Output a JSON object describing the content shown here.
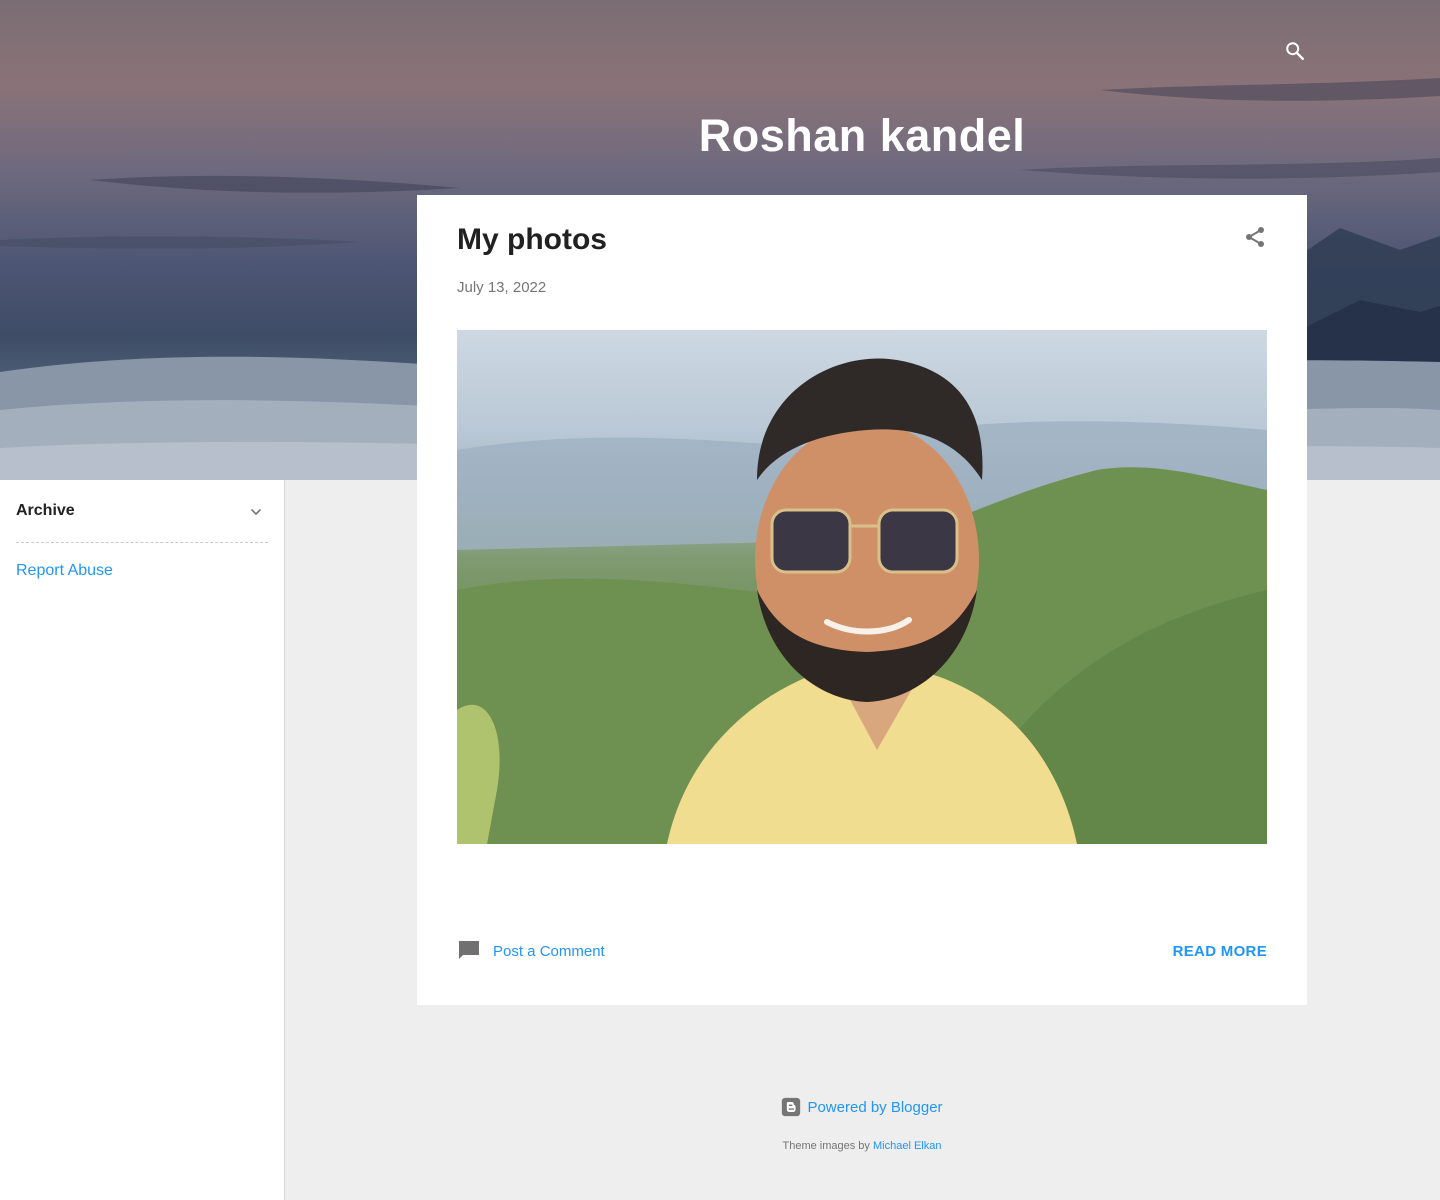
{
  "header": {
    "blog_title": "Roshan kandel",
    "search_icon": "search-icon"
  },
  "sidebar": {
    "archive_label": "Archive",
    "archive_icon": "chevron-down-icon",
    "report_abuse_label": "Report Abuse"
  },
  "post": {
    "title": "My photos",
    "date": "July 13, 2022",
    "share_icon": "share-icon",
    "comment_icon": "comment-icon",
    "comment_label": "Post a Comment",
    "read_more_label": "Read more"
  },
  "footer": {
    "powered_icon": "blogger-icon",
    "powered_label": "Powered by Blogger",
    "attribution_prefix": "Theme images by",
    "attribution_author": "Michael Elkan"
  },
  "colors": {
    "accent": "#2196f3",
    "page_background": "#eeeeee",
    "card_background": "#ffffff",
    "title_text": "#212121",
    "meta_text": "#757575"
  }
}
